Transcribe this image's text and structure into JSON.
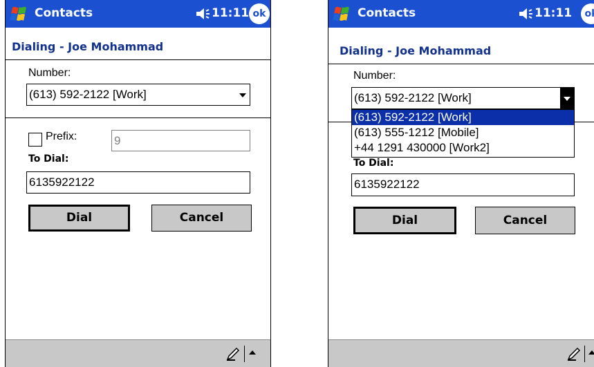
{
  "title_bar": {
    "app_title": "Contacts",
    "time": "11:11",
    "ok_label": "ok"
  },
  "dialog": {
    "heading": "Dialing - Joe Mohammad",
    "number_label": "Number:",
    "number_value": "(613) 592-2122 [Work]",
    "prefix_label": "Prefix:",
    "prefix_value": "9",
    "to_dial_label": "To Dial:",
    "to_dial_value": "6135922122",
    "dial_button": "Dial",
    "cancel_button": "Cancel"
  },
  "number_options": [
    "(613) 592-2122 [Work]",
    "(613) 555-1212 [Mobile]",
    "+44 1291 430000 [Work2]"
  ],
  "colors": {
    "title_bar": "#1b50d0",
    "heading": "#12318e",
    "selection": "#0a2fa8",
    "button_face": "#c8c8c8"
  }
}
